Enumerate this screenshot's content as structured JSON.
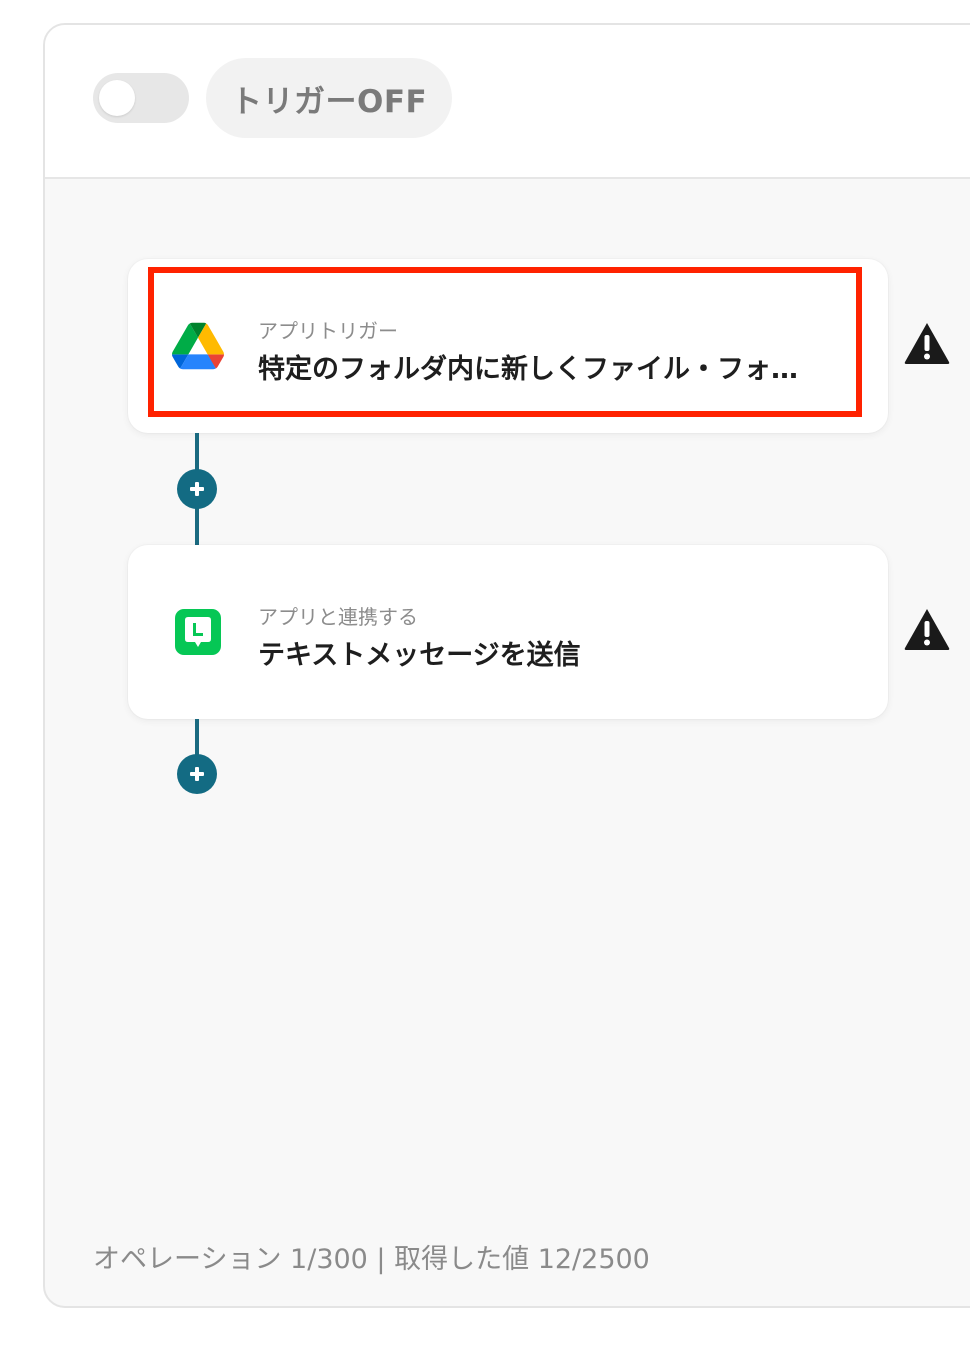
{
  "header": {
    "toggle_state": "off",
    "trigger_status_label": "トリガーOFF"
  },
  "flow": {
    "steps": [
      {
        "subtitle": "アプリトリガー",
        "title": "特定のフォルダ内に新しくファイル・フォ…",
        "app_icon": "google-drive-icon",
        "warning_icon": "warning-icon",
        "highlighted": true
      },
      {
        "subtitle": "アプリと連携する",
        "title": "テキストメッセージを送信",
        "app_icon": "line-icon",
        "warning_icon": "warning-icon",
        "highlighted": false
      }
    ],
    "add_step_icon": "plus-icon"
  },
  "footer": {
    "usage_text": "オペレーション 1/300 | 取得した値 12/2500"
  },
  "colors": {
    "accent": "#136b83",
    "highlight": "#ff2200",
    "line_green": "#06c755"
  }
}
